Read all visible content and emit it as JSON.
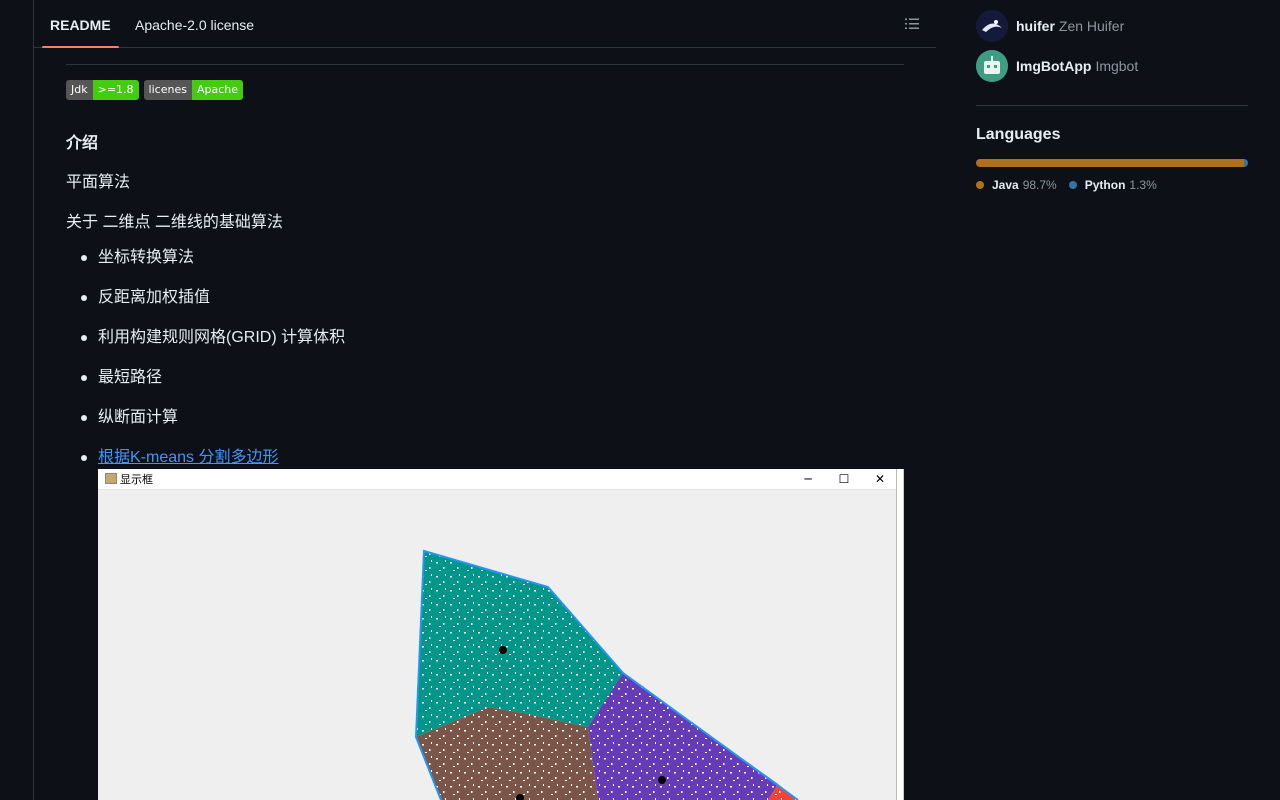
{
  "readme_header": {
    "tabs": [
      {
        "label": "README",
        "active": true
      },
      {
        "label": "Apache-2.0 license",
        "active": false
      }
    ],
    "toc_icon": "list-unordered-icon"
  },
  "readme": {
    "badges": [
      {
        "label": "Jdk",
        "value": ">=1.8",
        "color": "#44cc11"
      },
      {
        "label": "licenes",
        "value": "Apache",
        "color": "#44cc11"
      }
    ],
    "heading_intro": "介绍",
    "para_1": "平面算法",
    "para_2": "关于 二维点 二维线的基础算法",
    "list_items": [
      "坐标转换算法",
      "反距离加权插值",
      "利用构建规则网格(GRID) 计算体积",
      "最短路径",
      "纵断面计算"
    ],
    "kmeans_link": "根据K-means 分割多边形",
    "screenshot_window": {
      "title": "显示框",
      "min_glyph": "─",
      "max_glyph": "☐",
      "close_glyph": "✕",
      "region_colors": [
        "#00968a",
        "#7a5548",
        "#673ab7",
        "#f44336"
      ]
    }
  },
  "sidebar": {
    "contributors": [
      {
        "login": "huifer",
        "name": "Zen Huifer",
        "avatar_icon": "avatar-huifer"
      },
      {
        "login": "ImgBotApp",
        "name": "Imgbot",
        "avatar_icon": "avatar-imgbot"
      }
    ],
    "languages_title": "Languages",
    "languages": [
      {
        "name": "Java",
        "percent": "98.7%",
        "share": 98.7,
        "color": "#b07219"
      },
      {
        "name": "Python",
        "percent": "1.3%",
        "share": 1.3,
        "color": "#3572a5"
      }
    ]
  }
}
